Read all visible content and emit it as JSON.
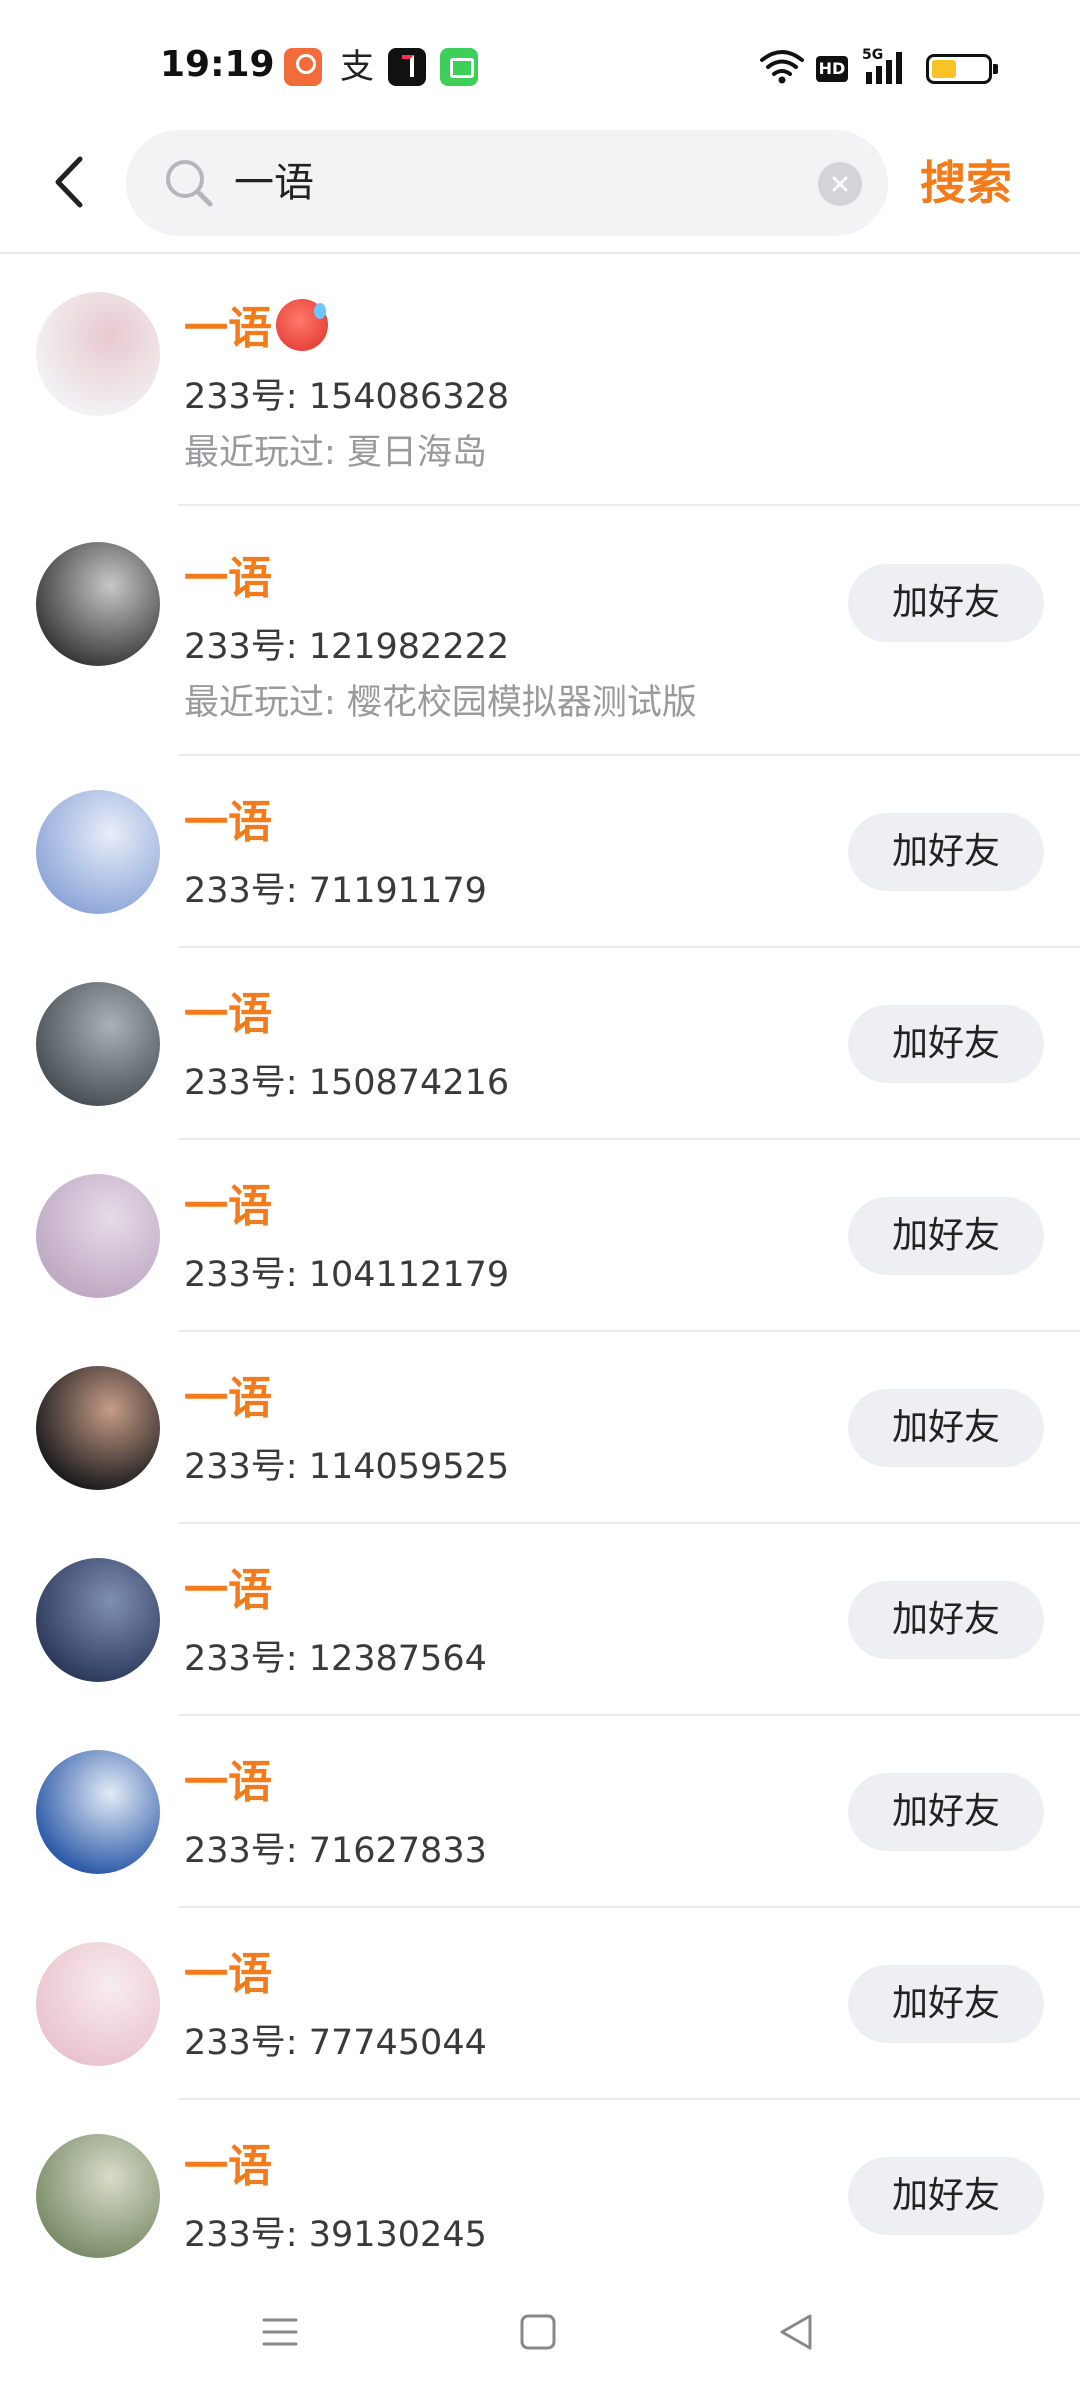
{
  "status_bar": {
    "time": "19:19",
    "app_icons": [
      "safety-app-icon",
      "alipay-icon",
      "douyin-icon",
      "wechat-mini-icon"
    ],
    "network": "5G",
    "hd_label": "HD",
    "battery_level": 0.45,
    "battery_color": "#f7c325"
  },
  "header": {
    "search_query": "一语",
    "submit_label": "搜索",
    "accent_color": "#f27b1c"
  },
  "results": [
    {
      "name": "一语",
      "has_emoji": true,
      "uid": "233号: 154086328",
      "played": "最近玩过: 夏日海岛",
      "add_label": "",
      "avatar_colors": [
        "#f2f2f4",
        "#e8c9cf"
      ]
    },
    {
      "name": "一语",
      "uid": "233号: 121982222",
      "played": "最近玩过: 樱花校园模拟器测试版",
      "add_label": "加好友",
      "avatar_colors": [
        "#3a3a3a",
        "#c7c7c7"
      ]
    },
    {
      "name": "一语",
      "uid": "233号: 71191179",
      "played": "",
      "add_label": "加好友",
      "avatar_colors": [
        "#8fa7d9",
        "#e8eef9"
      ]
    },
    {
      "name": "一语",
      "uid": "233号: 150874216",
      "played": "",
      "add_label": "加好友",
      "avatar_colors": [
        "#4a5157",
        "#a9b2b6"
      ]
    },
    {
      "name": "一语",
      "uid": "233号: 104112179",
      "played": "",
      "add_label": "加好友",
      "avatar_colors": [
        "#bfa9c3",
        "#e6dbe8"
      ]
    },
    {
      "name": "一语",
      "uid": "233号: 114059525",
      "played": "",
      "add_label": "加好友",
      "avatar_colors": [
        "#1c1c1f",
        "#c79c86"
      ]
    },
    {
      "name": "一语",
      "uid": "233号: 12387564",
      "played": "",
      "add_label": "加好友",
      "avatar_colors": [
        "#2d3a5c",
        "#7f8fb4"
      ]
    },
    {
      "name": "一语",
      "uid": "233号: 71627833",
      "played": "",
      "add_label": "加好友",
      "avatar_colors": [
        "#2c5aa8",
        "#e3ebf7"
      ]
    },
    {
      "name": "一语",
      "uid": "233号: 77745044",
      "played": "",
      "add_label": "加好友",
      "avatar_colors": [
        "#e9c4cf",
        "#f8ecef"
      ]
    },
    {
      "name": "一语",
      "uid": "233号: 39130245",
      "played": "",
      "add_label": "加好友",
      "avatar_colors": [
        "#7c8d6a",
        "#d8dcc9"
      ]
    }
  ],
  "nav_bar": {
    "buttons": [
      "menu-icon",
      "home-icon",
      "back-triangle-icon"
    ]
  }
}
